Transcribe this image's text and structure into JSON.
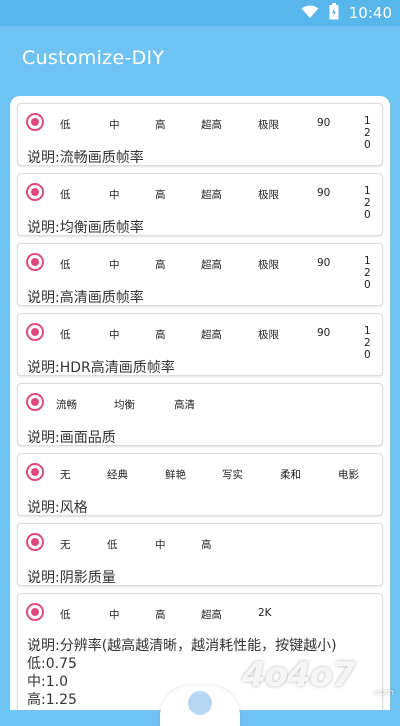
{
  "status_bar": {
    "time": "10:40",
    "icons": [
      "wifi-icon",
      "battery-icon"
    ]
  },
  "app": {
    "title": "Customize-DIY"
  },
  "colors": {
    "primary": "#6ec3f2",
    "radio_accent": "#e04a7a"
  },
  "cards": [
    {
      "options": [
        "低",
        "中",
        "高",
        "超高",
        "极限",
        "90",
        "120"
      ],
      "description": "说明:流畅画质帧率"
    },
    {
      "options": [
        "低",
        "中",
        "高",
        "超高",
        "极限",
        "90",
        "120"
      ],
      "description": "说明:均衡画质帧率"
    },
    {
      "options": [
        "低",
        "中",
        "高",
        "超高",
        "极限",
        "90",
        "120"
      ],
      "description": "说明:高清画质帧率"
    },
    {
      "options": [
        "低",
        "中",
        "高",
        "超高",
        "极限",
        "90",
        "120"
      ],
      "description": "说明:HDR高清画质帧率"
    },
    {
      "options": [
        "流畅",
        "均衡",
        "高清"
      ],
      "description": "说明:画面品质"
    },
    {
      "options": [
        "无",
        "经典",
        "鲜艳",
        "写实",
        "柔和",
        "电影"
      ],
      "description": "说明:风格"
    },
    {
      "options": [
        "无",
        "低",
        "中",
        "高"
      ],
      "description": "说明:阴影质量"
    },
    {
      "options": [
        "低",
        "中",
        "高",
        "超高",
        "2K"
      ],
      "description": "说明:分辨率(越高越清晰，越消耗性能，按键越小)",
      "extra_lines": [
        "低:0.75",
        "中:1.0",
        "高:1.25"
      ]
    }
  ],
  "watermark": {
    "text": "4o4o7",
    "suffix": ".com"
  }
}
